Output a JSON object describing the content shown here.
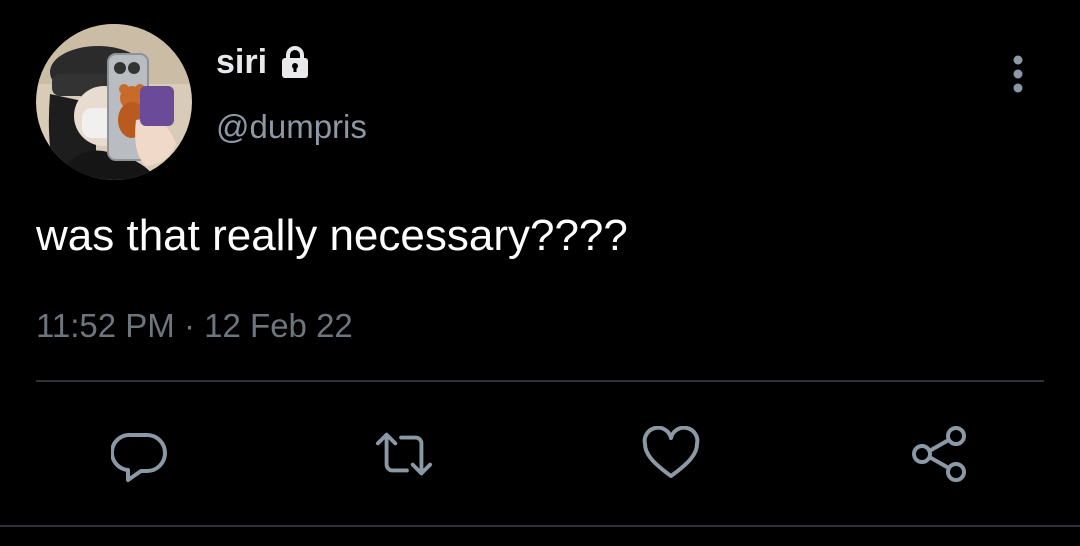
{
  "tweet": {
    "display_name": "siri",
    "handle": "@dumpris",
    "text": "was that really necessary????",
    "time": "11:52 PM",
    "separator": "·",
    "date": "12 Feb 22"
  },
  "icons": {
    "lock": "lock-icon",
    "more": "more-vertical-icon",
    "reply": "reply-icon",
    "retweet": "retweet-icon",
    "like": "heart-icon",
    "share": "share-icon"
  },
  "colors": {
    "background": "#000000",
    "primary_text": "#e7e9ea",
    "secondary_text": "#8b98a5",
    "icon": "#8b98a5",
    "divider": "#2f3336"
  }
}
